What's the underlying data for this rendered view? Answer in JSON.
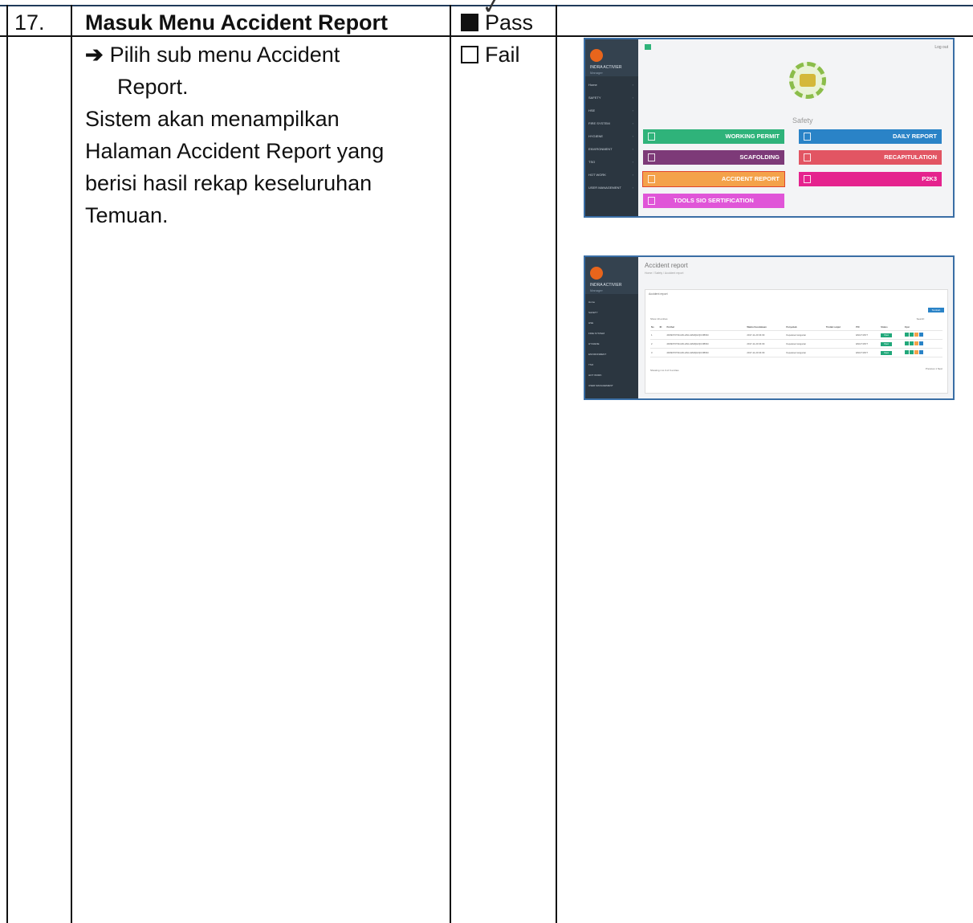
{
  "row": {
    "number": "17.",
    "title": "Masuk Menu Accident Report",
    "step_arrow": "➔",
    "step_line1": "Pilih sub menu Accident",
    "step_line2": "Report.",
    "description_lines": [
      "Sistem akan menampilkan",
      "Halaman Accident Report yang",
      "berisi hasil rekap keseluruhan",
      "Temuan."
    ],
    "result_options": [
      {
        "label": "Pass",
        "checked": true
      },
      {
        "label": "Fail",
        "checked": false
      }
    ]
  },
  "screenshot1": {
    "user_name": "INDRA ACTIVIER",
    "user_role": "Manager",
    "logout": "Log out",
    "menu": [
      "Home",
      "SAFETY",
      "HSE",
      "FIRE SYSTEM",
      "HYGIENE",
      "ENVIRONMENT",
      "TSO",
      "HOT WORK",
      "USER MANAGEMENT"
    ],
    "section_label": "Safety",
    "tiles": [
      {
        "label": "WORKING PERMIT",
        "color": "#2fb37a"
      },
      {
        "label": "DAILY REPORT",
        "color": "#2a83c7"
      },
      {
        "label": "SCAFOLDING",
        "color": "#7d3a78"
      },
      {
        "label": "RECAPITULATION",
        "color": "#e25563"
      },
      {
        "label": "ACCIDENT REPORT",
        "color": "#f4a24a"
      },
      {
        "label": "P2K3",
        "color": "#e5238e"
      },
      {
        "label": "TOOLS SIO SERTIFICATION",
        "color": "#e055d8"
      }
    ]
  },
  "screenshot2": {
    "user_name": "INDRA ACTIVIER",
    "user_role": "Manager",
    "menu": [
      "Home",
      "SAFETY",
      "HSE",
      "FIRE SYSTEM",
      "HYGIENE",
      "ENVIRONMENT",
      "TSO",
      "HOT WORK",
      "USER MANAGEMENT"
    ],
    "page_title": "Accident report",
    "breadcrumb": "Home / Safety / Accident report",
    "panel_title": "Accident report",
    "add_button": "Tambah",
    "show_label": "Show 10 entries",
    "search_label": "Search:",
    "columns": [
      "No",
      "ID",
      "Perihal",
      "Waktu Kecelakaan",
      "Penyebab",
      "Tindak Lanjut",
      "PIC",
      "Status",
      "Opsi"
    ],
    "rows": [
      {
        "no": "1",
        "perihal": "2D09070731G09-HSG-WHD[HO]COBSM",
        "waktu": "2017-11-20 04:09",
        "penyebab": "Kepeleset tangucan",
        "pic": "ENGT MOT",
        "status": "Open"
      },
      {
        "no": "2",
        "perihal": "2D09070731G09-HSG-WHD[HO]COBSM",
        "waktu": "2017-11-20 04:09",
        "penyebab": "Kepeleset tangucan",
        "pic": "ENGT MOT",
        "status": "Open"
      },
      {
        "no": "3",
        "perihal": "2D09070731G09-HSG-WHD[HO]COBSM",
        "waktu": "2017-11-20 04:09",
        "penyebab": "Kepeleset tangucan",
        "pic": "ENGT MOT",
        "status": "Open"
      }
    ],
    "footer": "Showing 1 to 3 of 3 entries",
    "pager": "Previous  1  Next"
  }
}
